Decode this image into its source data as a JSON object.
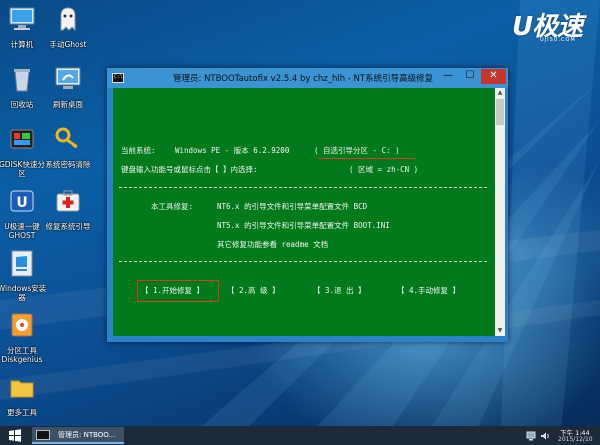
{
  "desktop": {
    "icons": [
      {
        "label": "计算机"
      },
      {
        "label": "手动Ghost"
      },
      {
        "label": "回收站"
      },
      {
        "label": "刷新桌面"
      },
      {
        "label": "GDISK快速分区"
      },
      {
        "label": "系统密码清除"
      },
      {
        "label": "U极速一键GHOST"
      },
      {
        "label": "修复系统引导"
      },
      {
        "label": "Windows安装器"
      },
      {
        "label": "分区工具Diskgenius"
      },
      {
        "label": "更多工具"
      }
    ],
    "logo": {
      "main": "U极速",
      "sub": "UJISU.COM"
    }
  },
  "window": {
    "title": "管理员:  NTBOOTautofix v2.5.4 by chz_hlh - NT系统引导高级修复",
    "icon_text": "C:\\",
    "min_label": "—",
    "max_label": "☐",
    "close_label": "✕"
  },
  "console": {
    "current_system_label": "当前系统:",
    "current_system_value": "Windows PE - 版本 6.2.9200",
    "partition_hint": "( 自选引导分区 - C: )",
    "keyboard_prompt": "键盘输入功能号或鼠标点击【 】内选择:",
    "locale": "( 区域 = zh-CN )",
    "repair_label": "本工具修复:",
    "repair_nt6": "NT6.x 的引导文件和引导菜单配置文件 BCD",
    "repair_nt5": "NT5.x 的引导文件和引导菜单配置文件 BOOT.INI",
    "repair_other": "其它修复功能参看 readme 文档",
    "options": [
      {
        "label": "【 1.开始修复 】"
      },
      {
        "label": "【 2.高  级 】"
      },
      {
        "label": "【 3.退  出 】"
      },
      {
        "label": "【 4.手动修复 】"
      }
    ]
  },
  "taskbar": {
    "task_label": "管理员: NTBOO...",
    "time": "下午 1:44",
    "date": "2015/12/10"
  },
  "colors": {
    "console_bg": "#007a1a",
    "highlight_red": "#d23a2a",
    "window_frame": "#2a83c8",
    "close_red": "#c7362c"
  }
}
